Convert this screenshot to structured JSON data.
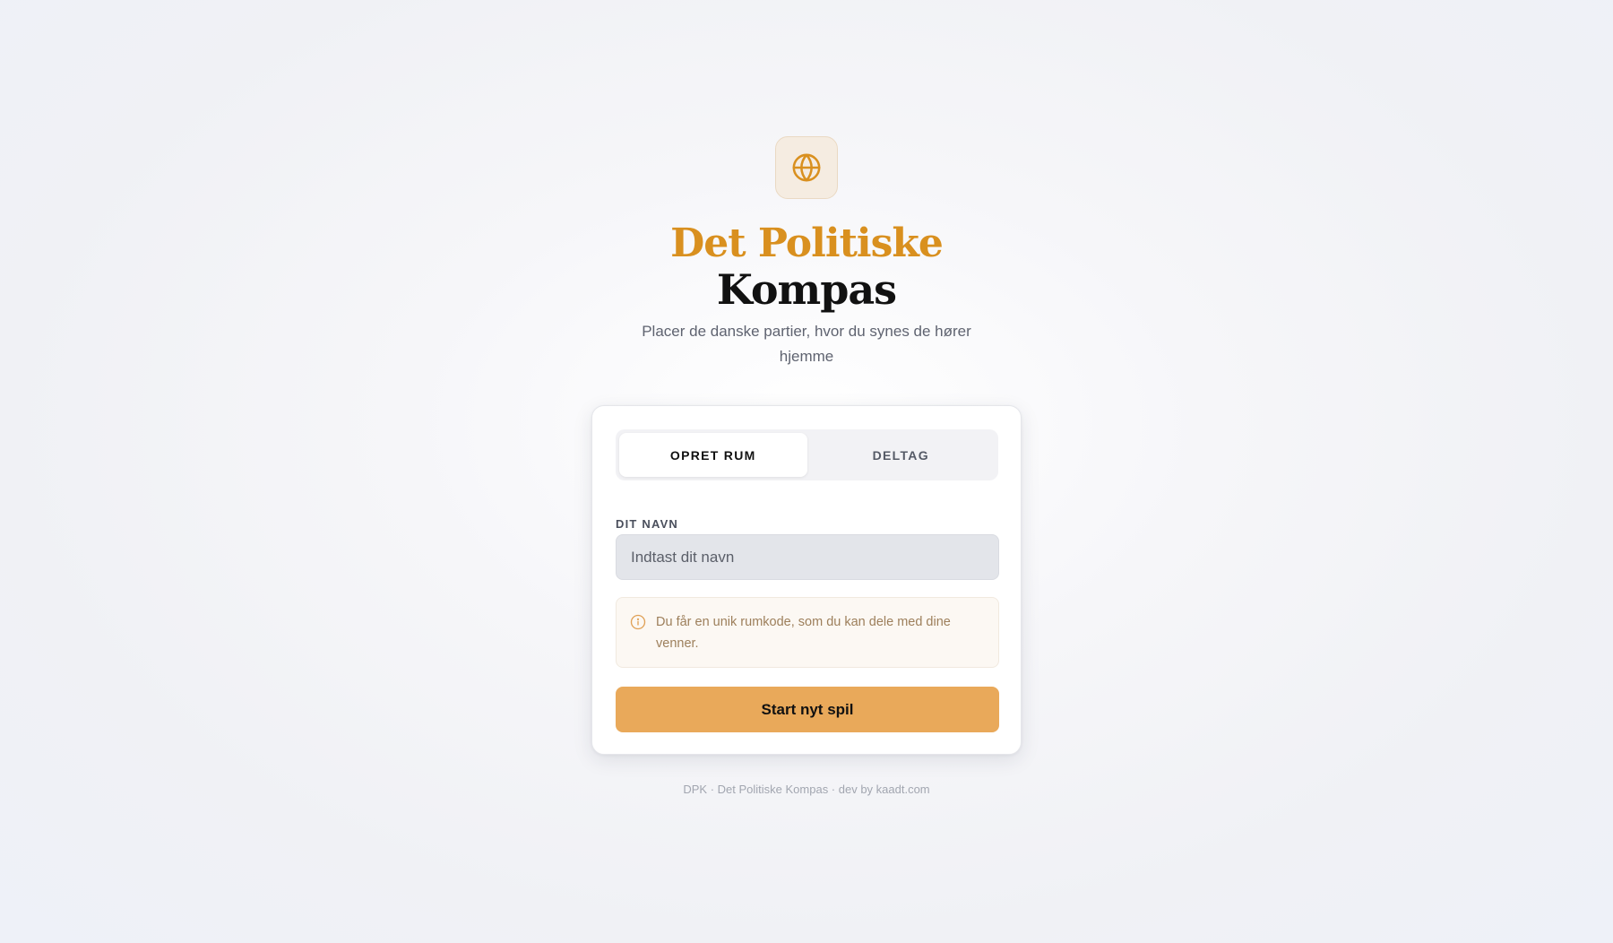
{
  "logo": {
    "icon": "globe-icon",
    "accent_color": "#d9901f"
  },
  "title": {
    "line1": "Det Politiske",
    "line2": "Kompas"
  },
  "subtitle": "Placer de danske partier, hvor du synes de hører hjemme",
  "tabs": [
    {
      "label": "OPRET RUM",
      "active": true
    },
    {
      "label": "DELTAG",
      "active": false
    }
  ],
  "form": {
    "name_label": "DIT NAVN",
    "name_placeholder": "Indtast dit navn",
    "name_value": "",
    "info_icon": "info-circle-icon",
    "info_text": "Du får en unik rumkode, som du kan dele med dine venner.",
    "submit_label": "Start nyt spil"
  },
  "footer": "DPK · Det Politiske Kompas · dev by kaadt.com",
  "colors": {
    "accent": "#e9a95a",
    "title_accent": "#d9901f",
    "info_bg": "#fcf8f3",
    "info_text": "#9d7f5b"
  }
}
